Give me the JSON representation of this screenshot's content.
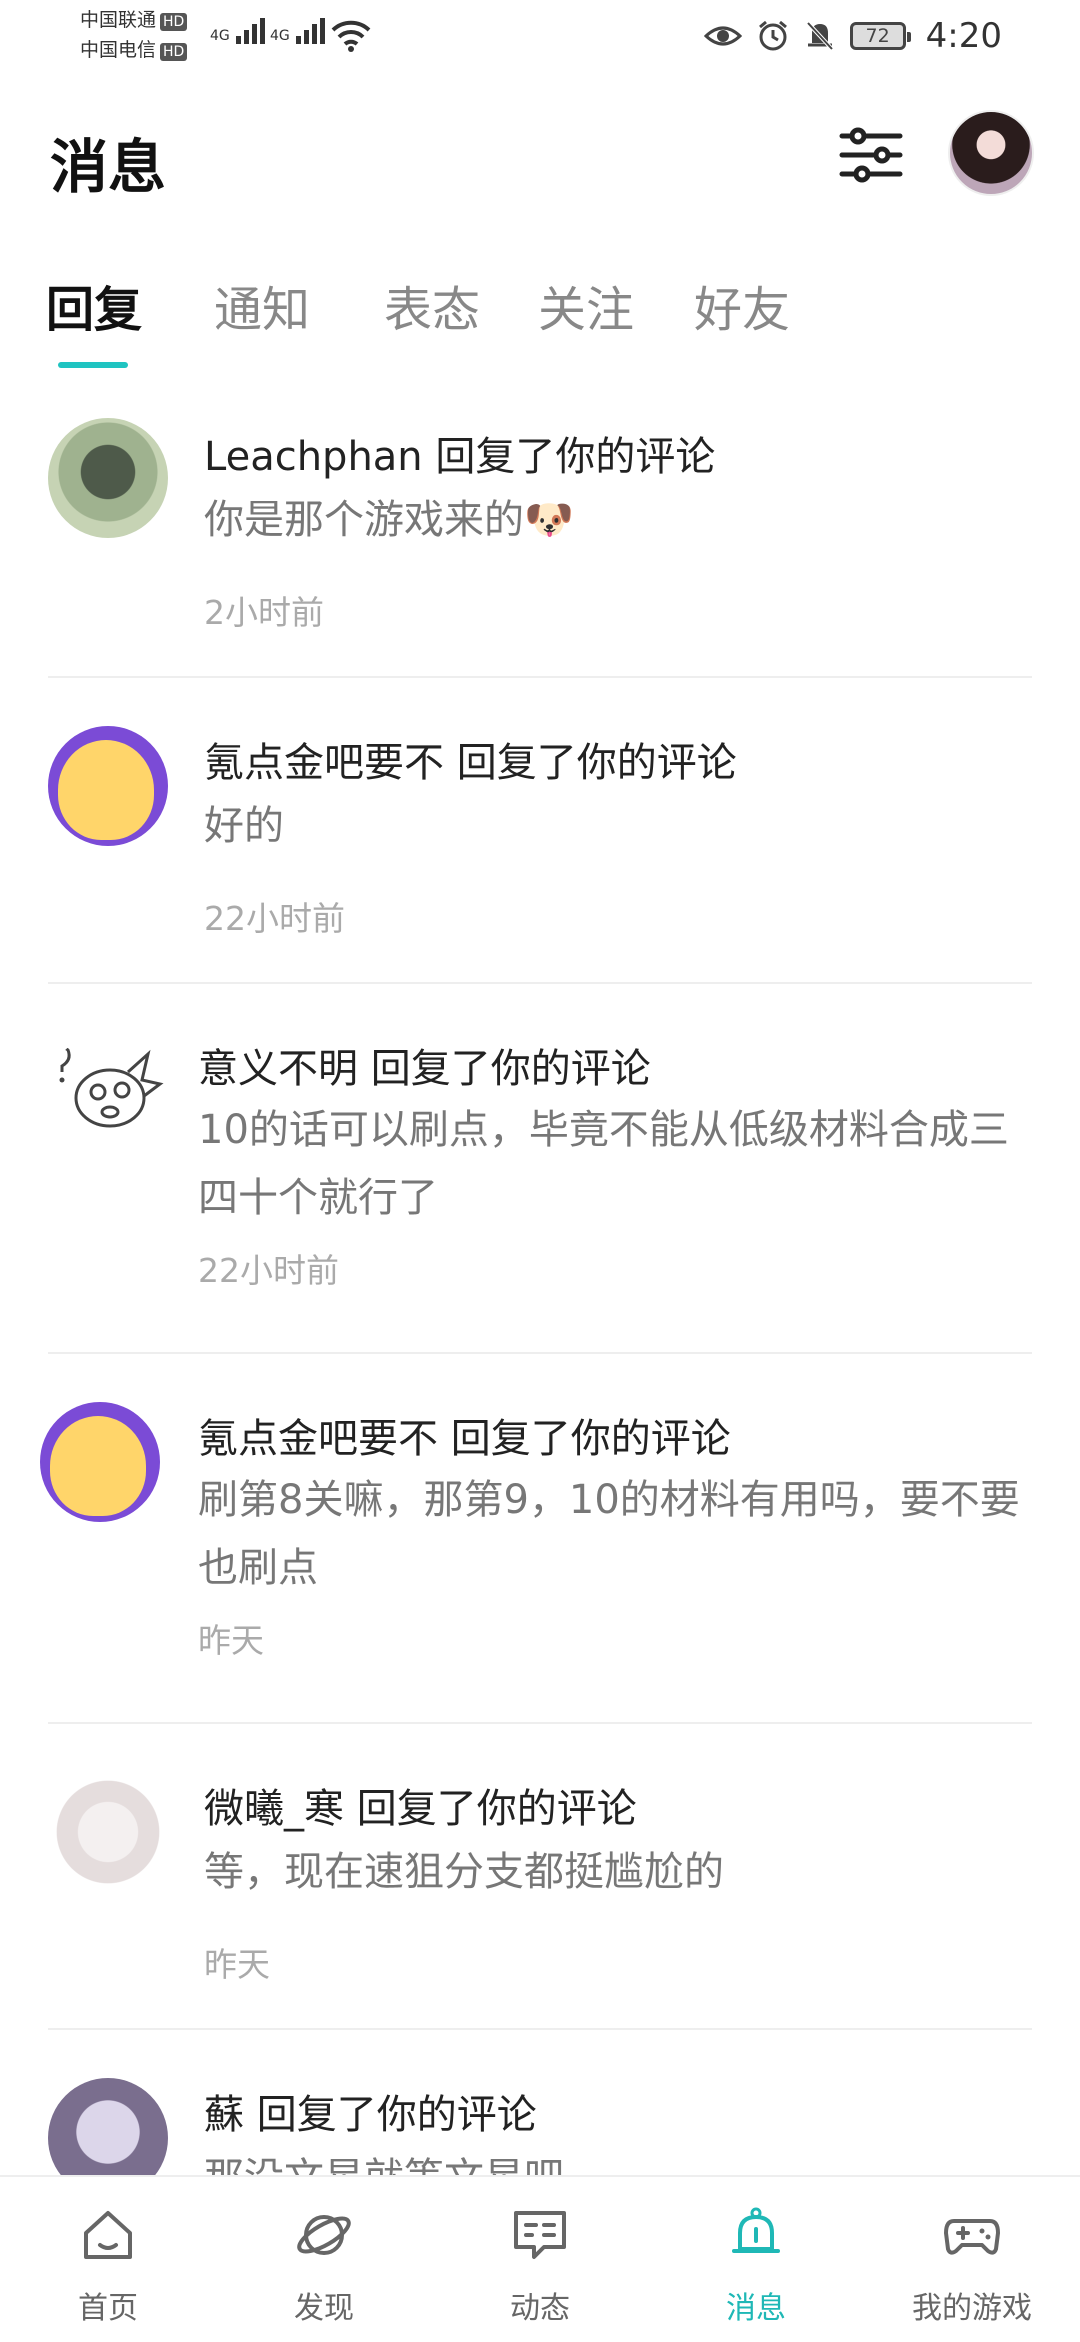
{
  "status_bar": {
    "carrier1": "中国联通",
    "carrier2": "中国电信",
    "hd": "HD",
    "network1": "4G",
    "network2": "4G",
    "battery": "72",
    "time": "4:20",
    "icons": [
      "eye-icon",
      "alarm-icon",
      "mute-icon",
      "wifi-icon"
    ]
  },
  "header": {
    "title": "消息"
  },
  "tabs": [
    {
      "label": "回复",
      "active": true
    },
    {
      "label": "通知"
    },
    {
      "label": "表态"
    },
    {
      "label": "关注"
    },
    {
      "label": "好友"
    }
  ],
  "messages": [
    {
      "title": "Leachphan 回复了你的评论",
      "content": "你是那个游戏来的🐶",
      "time": "2小时前"
    },
    {
      "title": "氪点金吧要不 回复了你的评论",
      "content": "好的",
      "time": "22小时前"
    },
    {
      "title": "意义不明 回复了你的评论",
      "content": "10的话可以刷点，毕竟不能从低级材料合成三四十个就行了",
      "time": "22小时前"
    },
    {
      "title": "氪点金吧要不 回复了你的评论",
      "content": "刷第8关嘛，那第9，10的材料有用吗，要不要也刷点",
      "time": "昨天"
    },
    {
      "title": "微曦_寒 回复了你的评论",
      "content": "等，现在速狙分支都挺尴尬的",
      "time": "昨天"
    },
    {
      "title": "蘇 回复了你的评论",
      "content": "那没文星就等文星吧",
      "time": ""
    }
  ],
  "bottom_nav": [
    {
      "label": "首页",
      "icon": "home-icon"
    },
    {
      "label": "发现",
      "icon": "planet-icon"
    },
    {
      "label": "动态",
      "icon": "chat-icon"
    },
    {
      "label": "消息",
      "icon": "bell-icon",
      "active": true
    },
    {
      "label": "我的游戏",
      "icon": "gamepad-icon"
    }
  ],
  "colors": {
    "accent": "#1fc4c1"
  }
}
